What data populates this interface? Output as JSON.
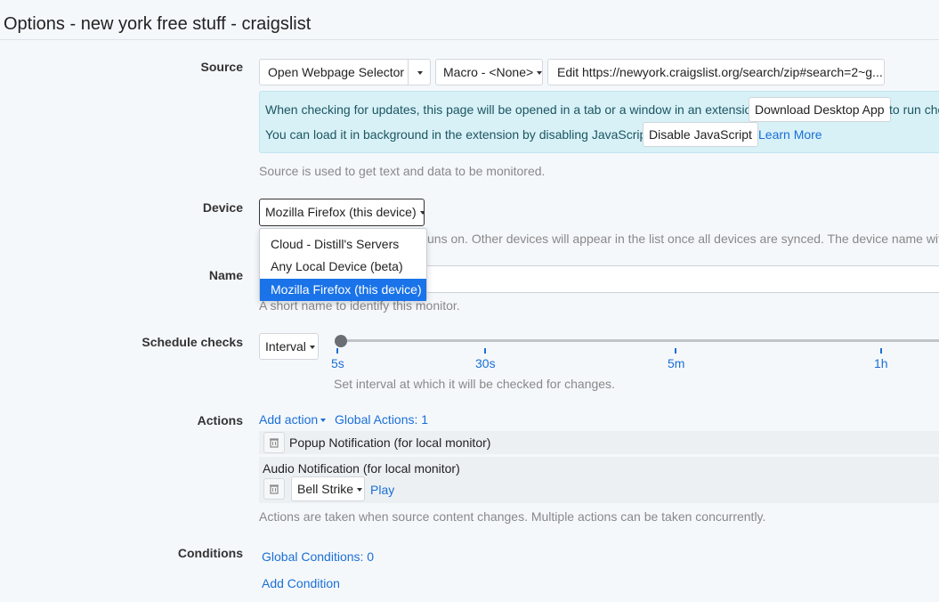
{
  "page_title": "Options - new york free stuff - craigslist",
  "source": {
    "label": "Source",
    "selector_button": "Open Webpage Selector",
    "macro_button": "Macro - <None>",
    "edit_button": "Edit https://newyork.craigslist.org/search/zip#search=2~g...",
    "info": {
      "line1": "When checking for updates, this page will be opened in a tab or a window in an extension.",
      "download_button": "Download Desktop App",
      "line1_tail": "to run che",
      "line2": "You can load it in background in the extension by disabling JavaScript.",
      "disable_js_button": "Disable JavaScript",
      "learn_more": "Learn More"
    },
    "help": "Source is used to get text and data to be monitored."
  },
  "device": {
    "label": "Device",
    "selected": "Mozilla Firefox (this device)",
    "help_tail": "uns on. Other devices will appear in the list once all devices are synced. The device name with s",
    "options": [
      "Cloud - Distill's Servers",
      "Any Local Device (beta)",
      "Mozilla Firefox (this device)"
    ]
  },
  "name": {
    "label": "Name",
    "help": "A short name to identify this monitor."
  },
  "schedule": {
    "label": "Schedule checks",
    "mode": "Interval",
    "ticks": [
      "5s",
      "30s",
      "5m",
      "1h"
    ],
    "value_fraction": 0,
    "help": "Set interval at which it will be checked for changes."
  },
  "actions": {
    "label": "Actions",
    "add_action": "Add action",
    "global_actions": "Global Actions: 1",
    "popup": "Popup Notification (for local monitor)",
    "audio": "Audio Notification (for local monitor)",
    "sound": "Bell Strike",
    "play": "Play",
    "help": "Actions are taken when source content changes. Multiple actions can be taken concurrently."
  },
  "conditions": {
    "label": "Conditions",
    "global_conditions": "Global Conditions: 0",
    "add_condition": "Add Condition"
  }
}
